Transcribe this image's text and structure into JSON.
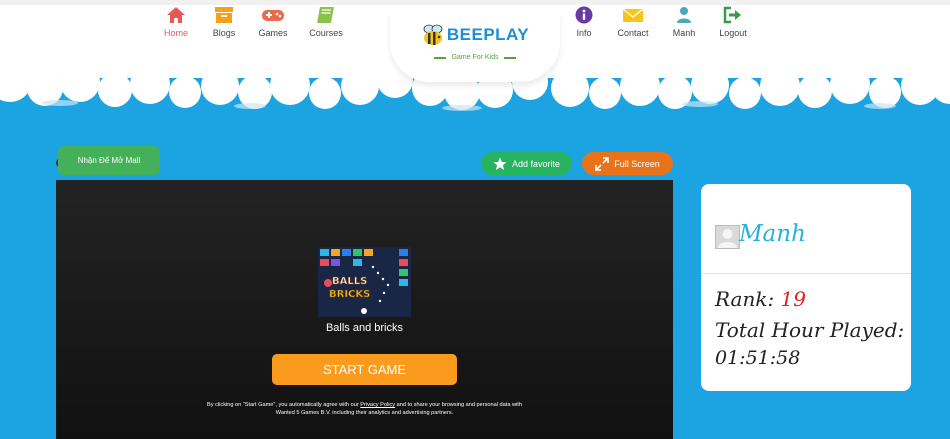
{
  "nav": {
    "items": [
      {
        "label": "Home",
        "icon": "home-icon",
        "active": true
      },
      {
        "label": "Blogs",
        "icon": "archive-icon"
      },
      {
        "label": "Games",
        "icon": "gamepad-icon"
      },
      {
        "label": "Courses",
        "icon": "book-icon"
      },
      {
        "label": "Info",
        "icon": "info-icon"
      },
      {
        "label": "Contact",
        "icon": "envelope-icon"
      },
      {
        "label": "Manh",
        "icon": "user-icon"
      },
      {
        "label": "Logout",
        "icon": "sign-out-icon"
      }
    ]
  },
  "logo": {
    "brand": "BEEPLAY",
    "tagline": "Game For Kids"
  },
  "game": {
    "reward_button": "Nhận Để Mở Mall",
    "favorite_button": "Add favorite",
    "fullscreen_button": "Full Screen",
    "title": "Balls and bricks",
    "start_button": "START GAME",
    "consent_before": "By clicking on \"Start Game\", you automatically agree with our ",
    "consent_link": "Privacy Policy",
    "consent_after": " and to share your browsing and personal data with Wanted 5 Games B.V. including their analytics and advertising partners.",
    "thumbnail_text_1": "BALLS",
    "thumbnail_text_2": "BRICKS"
  },
  "profile": {
    "username": "Manh",
    "rank_label": "Rank:",
    "rank_value": "19",
    "hours_label": "Total Hour Played:",
    "hours_value": "01:51:58"
  },
  "colors": {
    "sky": "#1ca4e2",
    "accent_orange": "#fb9b1e",
    "favorite_green": "#27b461",
    "fullscreen_orange": "#e8731a",
    "reward_green": "#45b05a",
    "highlight_red": "#e02020"
  }
}
